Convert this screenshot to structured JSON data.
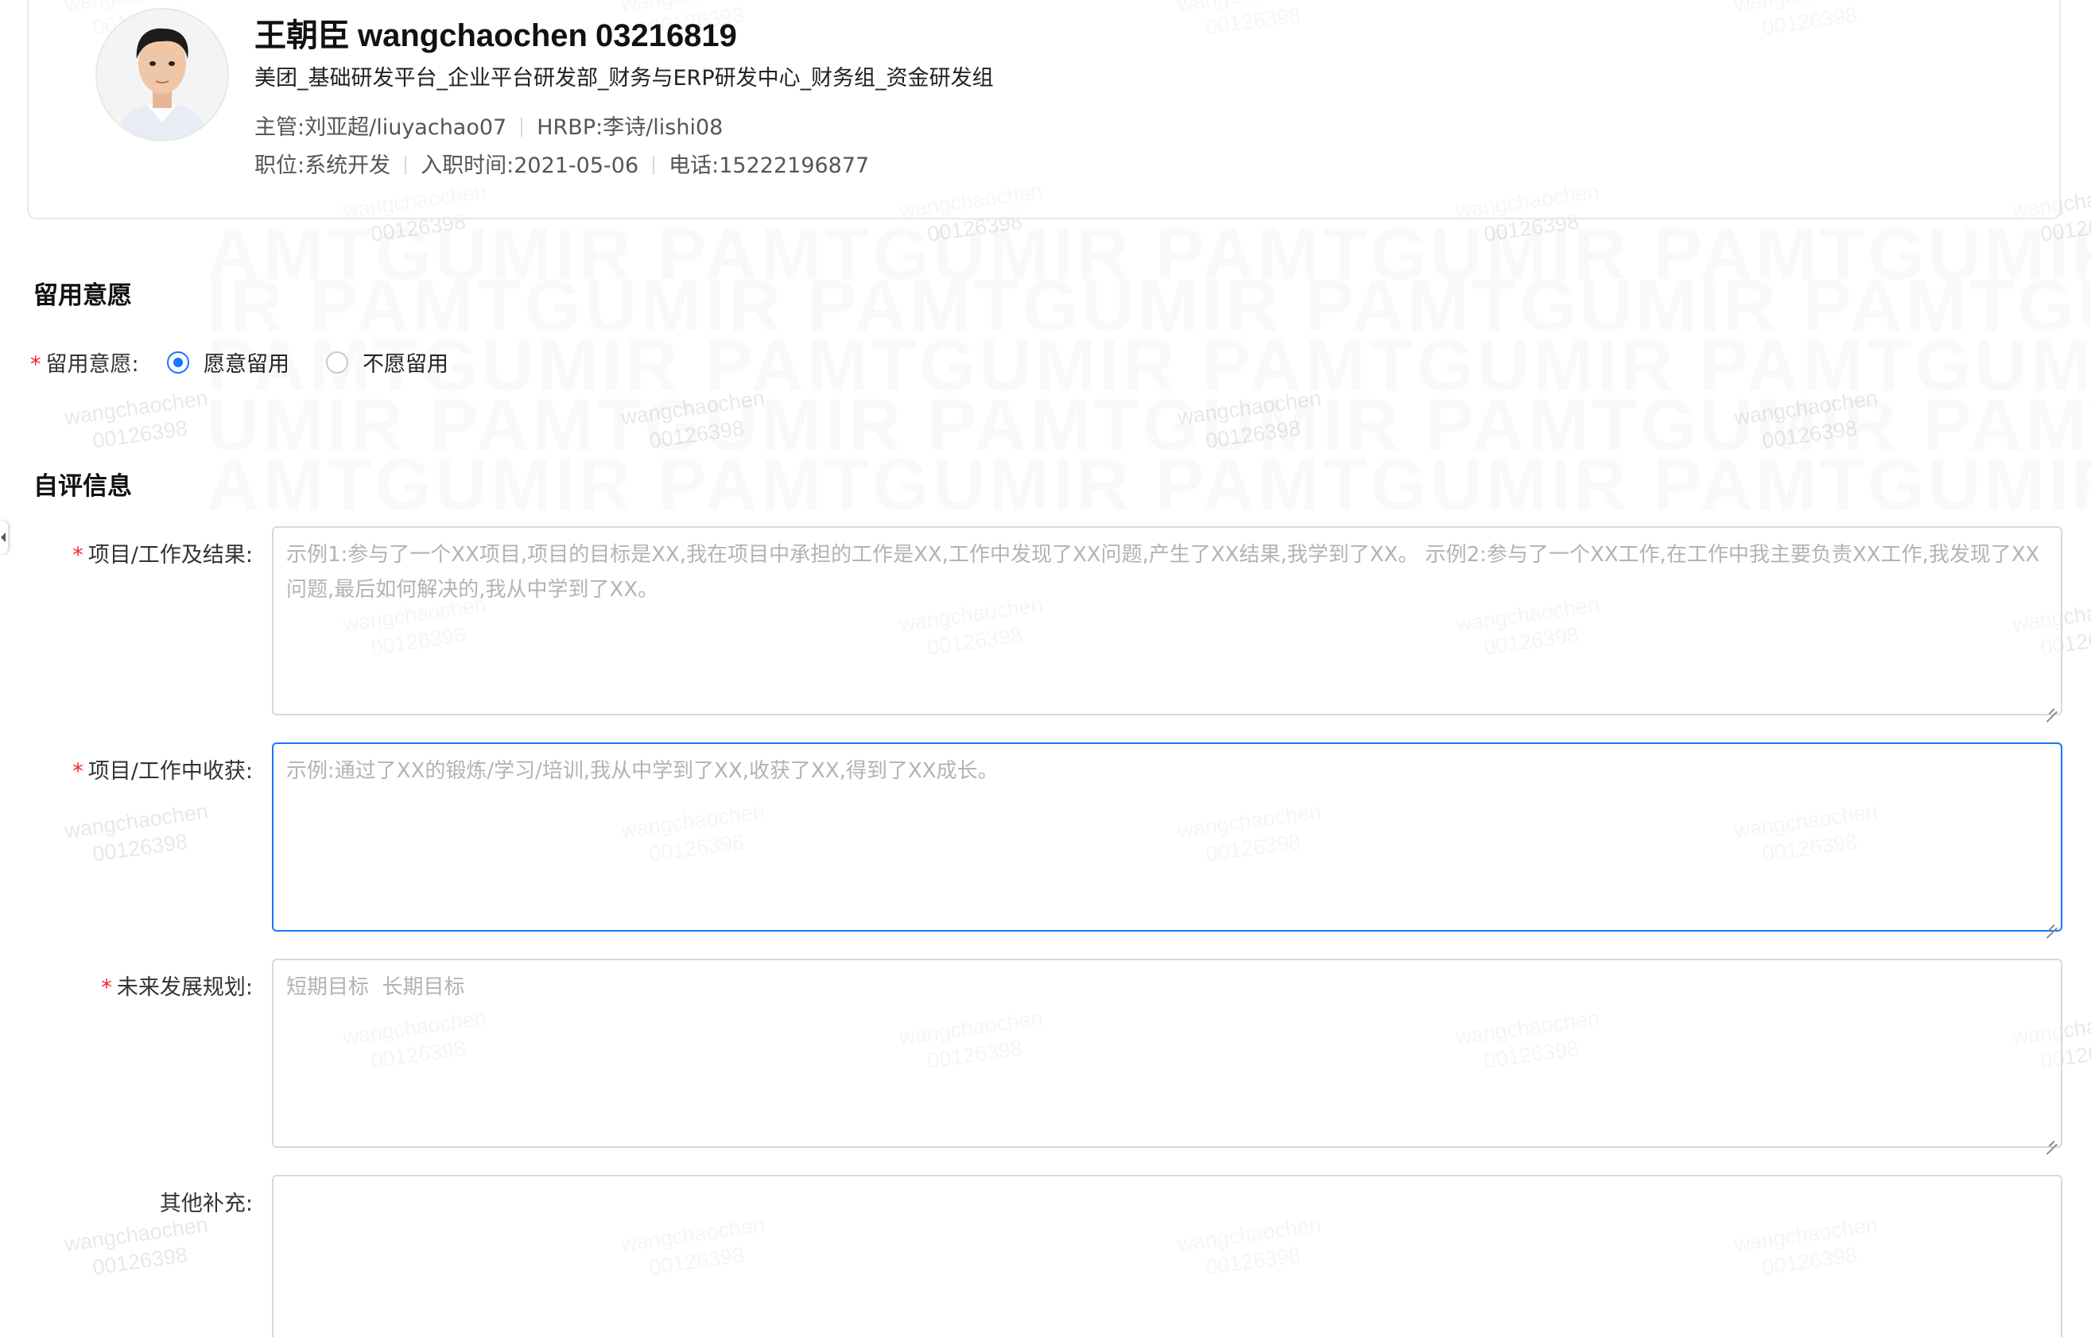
{
  "profile": {
    "name_cn": "王朝臣",
    "name_en": "wangchaochen",
    "employee_id": "03216819",
    "department": "美团_基础研发平台_企业平台研发部_财务与ERP研发中心_财务组_资金研发组",
    "manager_label": "主管:",
    "manager_value": "刘亚超/liuyachao07",
    "hrbp_label": "HRBP:",
    "hrbp_value": "李诗/lishi08",
    "position_label": "职位:",
    "position_value": "系统开发",
    "join_label": "入职时间:",
    "join_value": "2021-05-06",
    "phone_label": "电话:",
    "phone_value": "15222196877"
  },
  "retention": {
    "section_title": "留用意愿",
    "field_label": "留用意愿:",
    "options": [
      {
        "label": "愿意留用",
        "checked": true
      },
      {
        "label": "不愿留用",
        "checked": false
      }
    ]
  },
  "self_eval": {
    "section_title": "自评信息",
    "fields": [
      {
        "label": "项目/工作及结果:",
        "required": true,
        "value": "",
        "placeholder": "示例1:参与了一个XX项目,项目的目标是XX,我在项目中承担的工作是XX,工作中发现了XX问题,产生了XX结果,我学到了XX。 示例2:参与了一个XX工作,在工作中我主要负责XX工作,我发现了XX问题,最后如何解决的,我从中学到了XX。"
      },
      {
        "label": "项目/工作中收获:",
        "required": true,
        "value": "",
        "placeholder": "示例:通过了XX的锻炼/学习/培训,我从中学到了XX,收获了XX,得到了XX成长。"
      },
      {
        "label": "未来发展规划:",
        "required": true,
        "value": "",
        "placeholder": "短期目标  长期目标"
      },
      {
        "label": "其他补充:",
        "required": false,
        "value": "",
        "placeholder": ""
      }
    ]
  },
  "watermark": {
    "line1": "wangchaochen",
    "line2": "00126398"
  },
  "colors": {
    "accent": "#1677ff",
    "required": "#f5222d",
    "border": "#d9d9d9",
    "placeholder": "#b3b3b3"
  }
}
